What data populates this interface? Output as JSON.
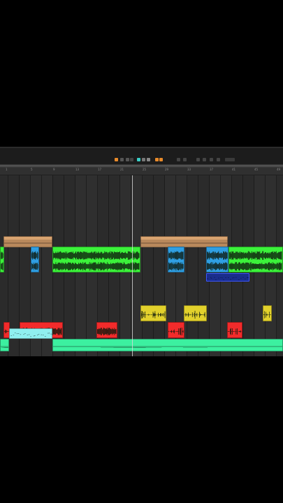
{
  "bar_numbers": [
    "1",
    "5",
    "9",
    "13",
    "17",
    "21",
    "25",
    "29",
    "33",
    "37",
    "41",
    "45",
    "49"
  ],
  "colors": {
    "orange": "#b9895c",
    "orange_head": "#d9a470",
    "blue": "#2f9fe3",
    "green": "#3bf23a",
    "navy": "#1a2d8c",
    "yellow": "#e2d12c",
    "red": "#f22b2b",
    "cyan": "#8ff0f0",
    "mint": "#3cf0a0"
  },
  "clips": [
    {
      "name": "",
      "color": "orange",
      "wave": "pad"
    },
    {
      "name": "",
      "color": "orange",
      "wave": "pad"
    },
    {
      "name": "",
      "color": "green",
      "wave": "dense"
    },
    {
      "name": "",
      "color": "blue",
      "wave": "dense"
    },
    {
      "name": "",
      "color": "green",
      "wave": "dense"
    },
    {
      "name": "",
      "color": "blue",
      "wave": "dense"
    },
    {
      "name": "",
      "color": "blue",
      "wave": "dense"
    },
    {
      "name": "",
      "color": "green",
      "wave": "dense"
    },
    {
      "name": "",
      "color": "navy",
      "wave": "midi"
    },
    {
      "name": "",
      "color": "yellow",
      "wave": "sparse"
    },
    {
      "name": "",
      "color": "yellow",
      "wave": "sparse"
    },
    {
      "name": "",
      "color": "yellow",
      "wave": "sparse"
    },
    {
      "name": "",
      "color": "red",
      "wave": "sparse"
    },
    {
      "name": "",
      "color": "red",
      "wave": "dense"
    },
    {
      "name": "",
      "color": "red",
      "wave": "dense"
    },
    {
      "name": "",
      "color": "red",
      "wave": "sparse"
    },
    {
      "name": "",
      "color": "red",
      "wave": "sparse"
    },
    {
      "name": "",
      "color": "cyan",
      "wave": "midi"
    },
    {
      "name": "",
      "color": "mint",
      "wave": "flat"
    },
    {
      "name": "",
      "color": "mint",
      "wave": "flat"
    }
  ]
}
